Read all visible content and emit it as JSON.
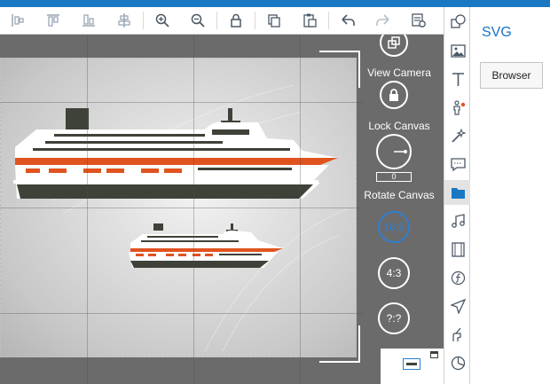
{
  "toolbar": {
    "icons": [
      "align-left-icon",
      "align-top-icon",
      "align-bottom-icon",
      "align-center-icon",
      "zoom-in-icon",
      "zoom-out-icon",
      "lock-icon",
      "copy-icon",
      "paste-icon",
      "undo-icon",
      "redo-icon",
      "properties-icon"
    ]
  },
  "side_controls": {
    "view_camera_label": "View Camera",
    "lock_canvas_label": "Lock Canvas",
    "rotate_canvas_label": "Rotate Canvas",
    "rotate_value": "0",
    "ratio_16_9": "16:9",
    "ratio_4_3": "4:3",
    "ratio_custom": "?:?"
  },
  "panel": {
    "title": "SVG",
    "browser_button": "Browser"
  },
  "colors": {
    "accent": "#1a78c2",
    "ship_orange": "#e0531f",
    "ship_dark": "#3e4238",
    "workspace_bg": "#6b6b6b"
  },
  "iconbar": {
    "icons": [
      "shapes-icon",
      "image-icon",
      "text-icon",
      "character-icon",
      "magic-wand-icon",
      "speech-bubble-icon",
      "folder-icon",
      "music-icon",
      "film-icon",
      "function-icon",
      "airplane-icon",
      "hand-pen-icon",
      "pie-chart-icon"
    ],
    "active": "folder-icon"
  }
}
